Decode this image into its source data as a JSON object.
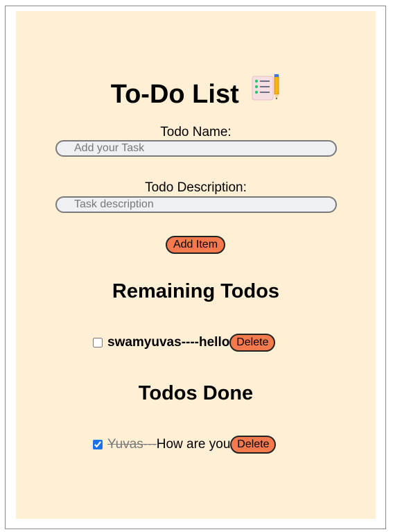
{
  "app": {
    "title": "To-Do List",
    "title_icon": "notepad-checklist-pencil-icon"
  },
  "form": {
    "name_label": "Todo Name:",
    "name_placeholder": "Add your Task",
    "name_value": "",
    "description_label": "Todo Description:",
    "description_placeholder": "Task description",
    "description_value": "",
    "add_button_label": "Add Item"
  },
  "remaining": {
    "heading": "Remaining Todos",
    "items": [
      {
        "name": "swamyuvas",
        "separator": "----",
        "description": "hello",
        "checked": false,
        "delete_label": "Delete"
      }
    ]
  },
  "done": {
    "heading": "Todos Done",
    "items": [
      {
        "name": "Yuvas",
        "separator": "---",
        "description": "How are you",
        "checked": true,
        "delete_label": "Delete"
      }
    ]
  },
  "colors": {
    "panel_background": "#ffefd5",
    "button_background": "#f47a4e",
    "input_background": "#eff0f3",
    "done_text": "#7a7a7a",
    "checkbox_accent": "#1a73e8"
  }
}
